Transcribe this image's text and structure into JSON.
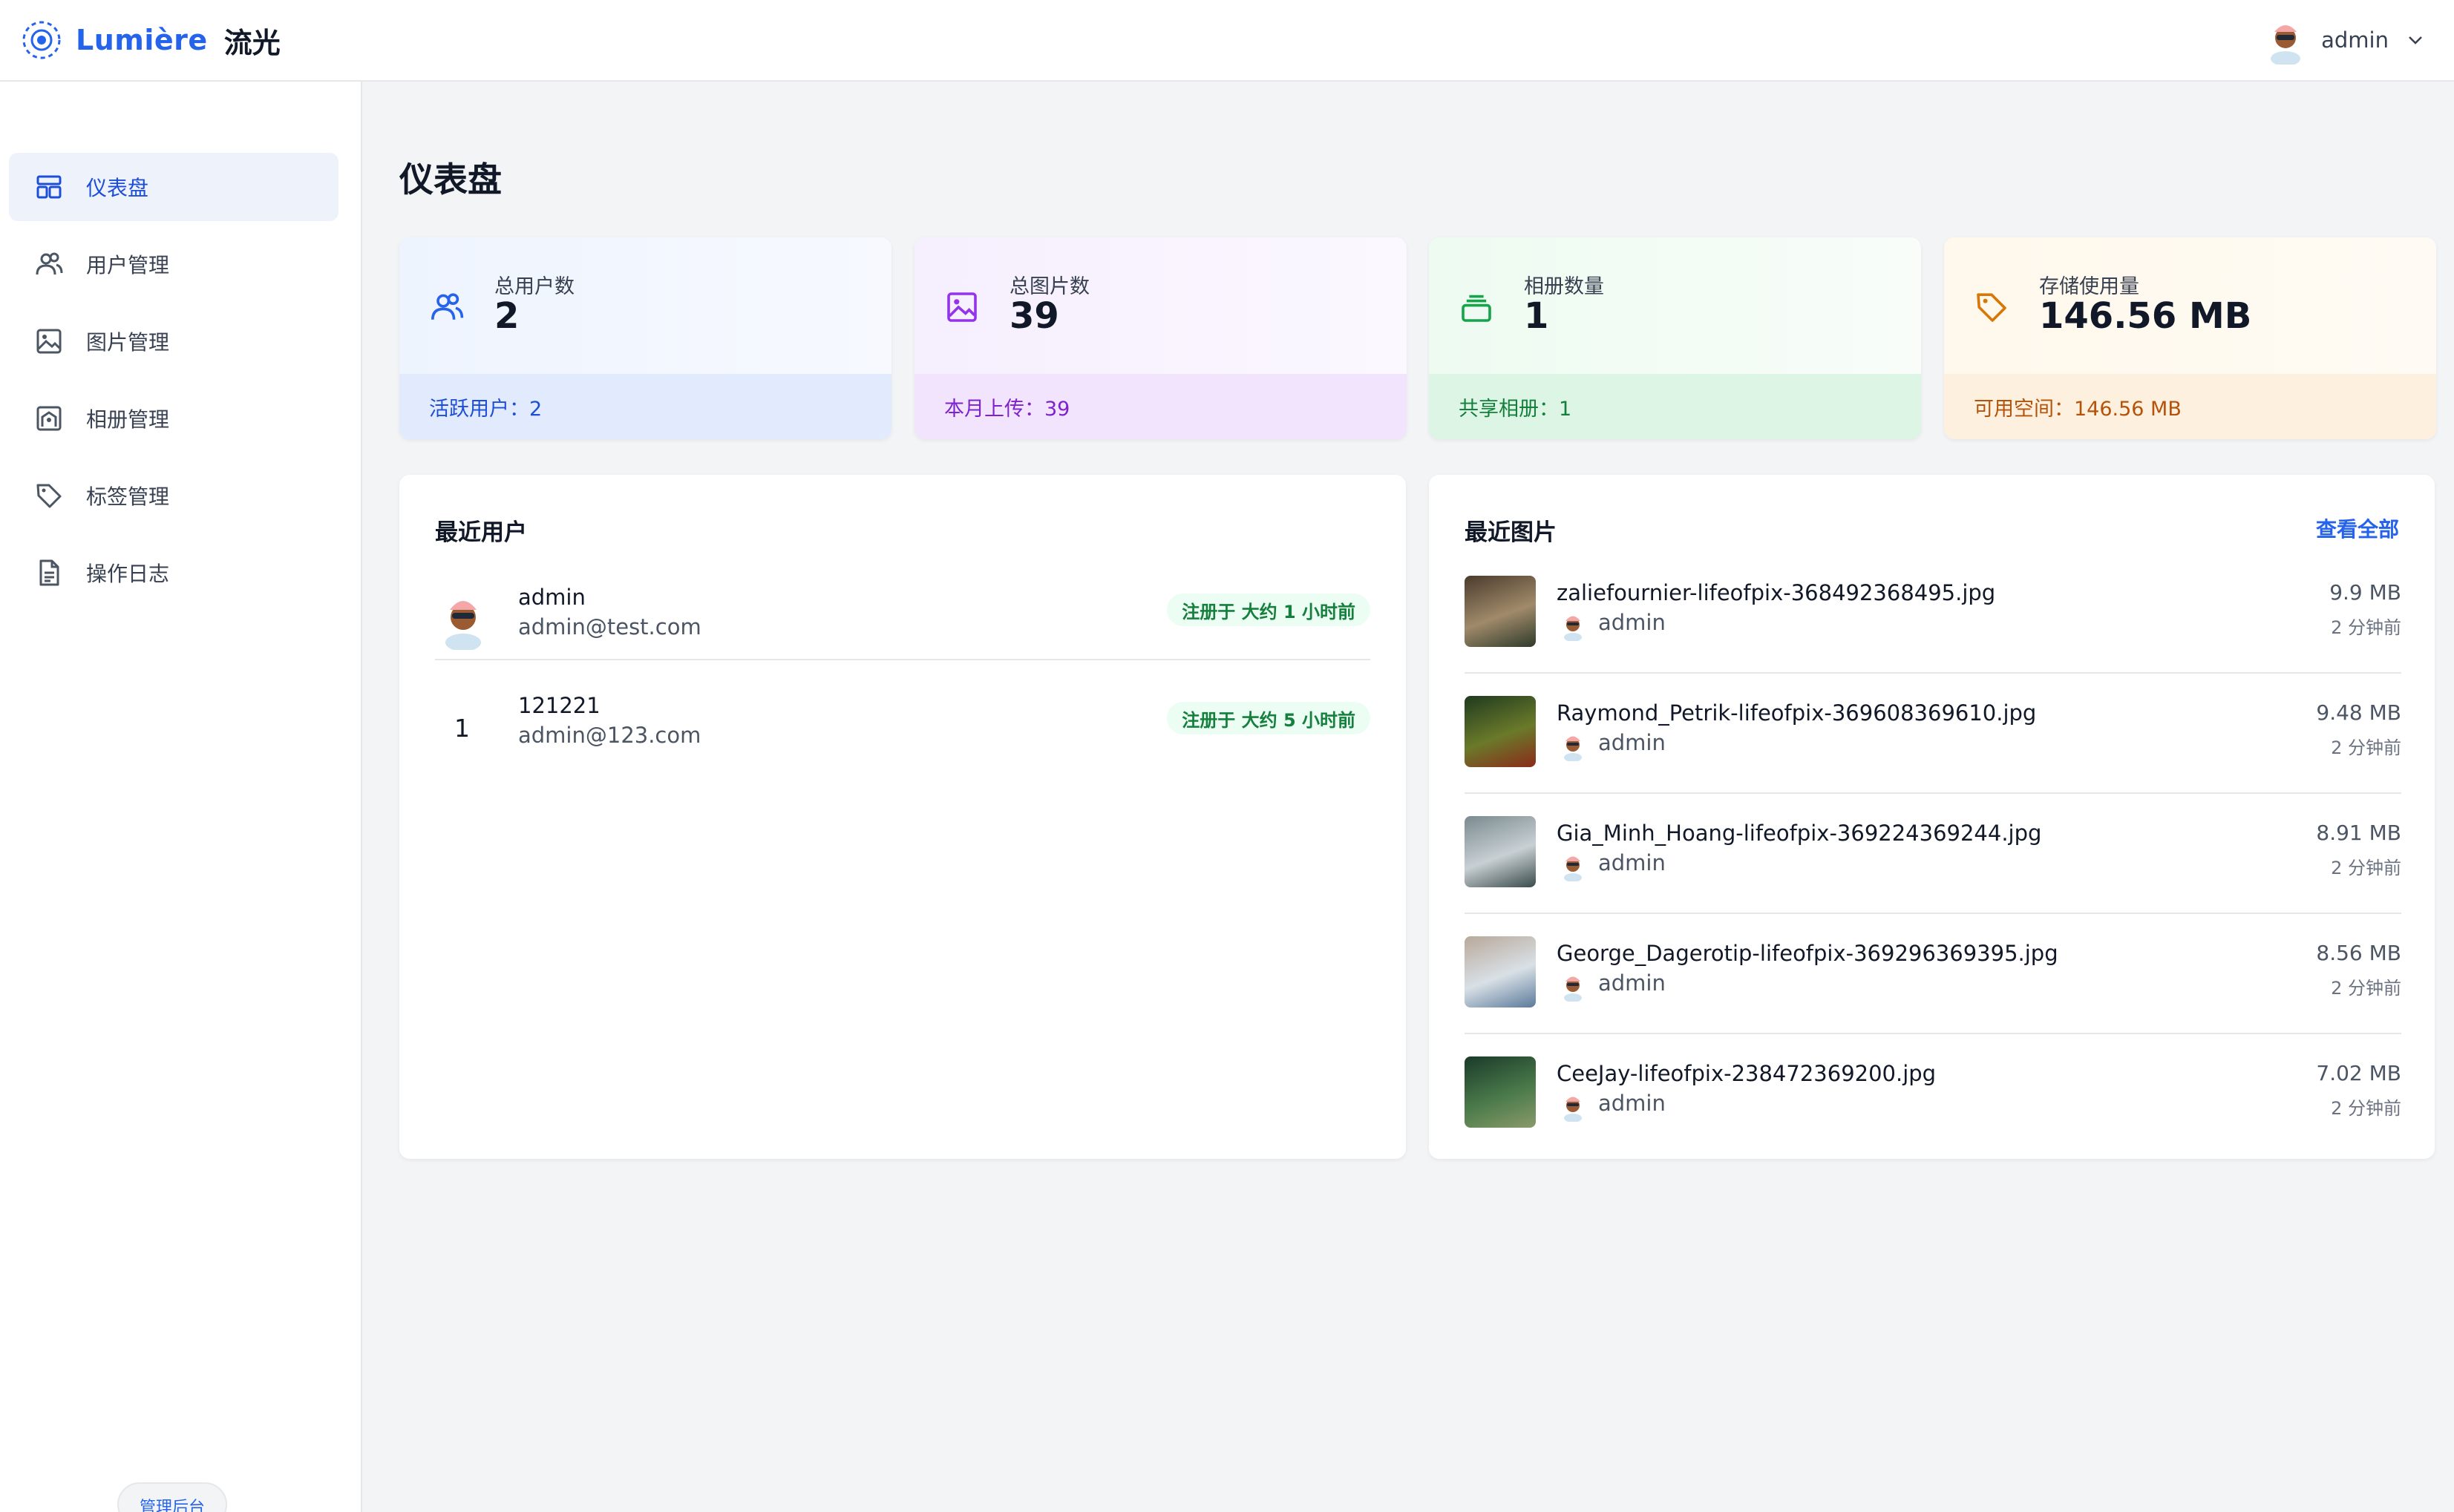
{
  "header": {
    "brand_en": "Lumière",
    "brand_cn": "流光",
    "user_name": "admin"
  },
  "sidebar": {
    "items": [
      {
        "label": "仪表盘",
        "icon": "dashboard-icon",
        "active": true
      },
      {
        "label": "用户管理",
        "icon": "users-icon",
        "active": false
      },
      {
        "label": "图片管理",
        "icon": "image-icon",
        "active": false
      },
      {
        "label": "相册管理",
        "icon": "album-icon",
        "active": false
      },
      {
        "label": "标签管理",
        "icon": "tag-icon",
        "active": false
      },
      {
        "label": "操作日志",
        "icon": "document-icon",
        "active": false
      }
    ],
    "footer_label": "管理后台"
  },
  "page": {
    "title": "仪表盘"
  },
  "stats": [
    {
      "label": "总用户数",
      "value": "2",
      "footer": "活跃用户：2",
      "icon": "users-icon",
      "accent": "#2563eb",
      "footer_color": "#1d4ed8"
    },
    {
      "label": "总图片数",
      "value": "39",
      "footer": "本月上传：39",
      "icon": "image-icon",
      "accent": "#9333ea",
      "footer_color": "#7e22ce"
    },
    {
      "label": "相册数量",
      "value": "1",
      "footer": "共享相册：1",
      "icon": "album-icon",
      "accent": "#16a34a",
      "footer_color": "#15803d"
    },
    {
      "label": "存储使用量",
      "value": "146.56 MB",
      "footer": "可用空间：146.56 MB",
      "icon": "tag-icon",
      "accent": "#d97706",
      "footer_color": "#b45309"
    }
  ],
  "recent_users": {
    "title": "最近用户",
    "rows": [
      {
        "avatar": "avatar-icon",
        "number": "",
        "name": "admin",
        "email": "admin@test.com",
        "badge": "注册于 大约 1 小时前"
      },
      {
        "avatar": "",
        "number": "1",
        "name": "121221",
        "email": "admin@123.com",
        "badge": "注册于 大约 5 小时前"
      }
    ]
  },
  "recent_images": {
    "title": "最近图片",
    "view_all": "查看全部",
    "rows": [
      {
        "filename": "zaliefournier-lifeofpix-368492368495.jpg",
        "owner": "admin",
        "size": "9.9 MB",
        "time": "2 分钟前",
        "thumb_colors": [
          "#4a3b2c",
          "#a08a6a",
          "#2f3a2a"
        ]
      },
      {
        "filename": "Raymond_Petrik-lifeofpix-369608369610.jpg",
        "owner": "admin",
        "size": "9.48 MB",
        "time": "2 分钟前",
        "thumb_colors": [
          "#1f3a1f",
          "#6a7a2a",
          "#8a2a1a"
        ]
      },
      {
        "filename": "Gia_Minh_Hoang-lifeofpix-369224369244.jpg",
        "owner": "admin",
        "size": "8.91 MB",
        "time": "2 分钟前",
        "thumb_colors": [
          "#7a8a8e",
          "#c8d0d4",
          "#3a4a4a"
        ]
      },
      {
        "filename": "George_Dagerotip-lifeofpix-369296369395.jpg",
        "owner": "admin",
        "size": "8.56 MB",
        "time": "2 分钟前",
        "thumb_colors": [
          "#b8a89a",
          "#d9e0e6",
          "#5a7a9a"
        ]
      },
      {
        "filename": "CeeJay-lifeofpix-238472369200.jpg",
        "owner": "admin",
        "size": "7.02 MB",
        "time": "2 分钟前",
        "thumb_colors": [
          "#1a3a2a",
          "#4a7a4a",
          "#8a9a6a"
        ]
      }
    ]
  }
}
